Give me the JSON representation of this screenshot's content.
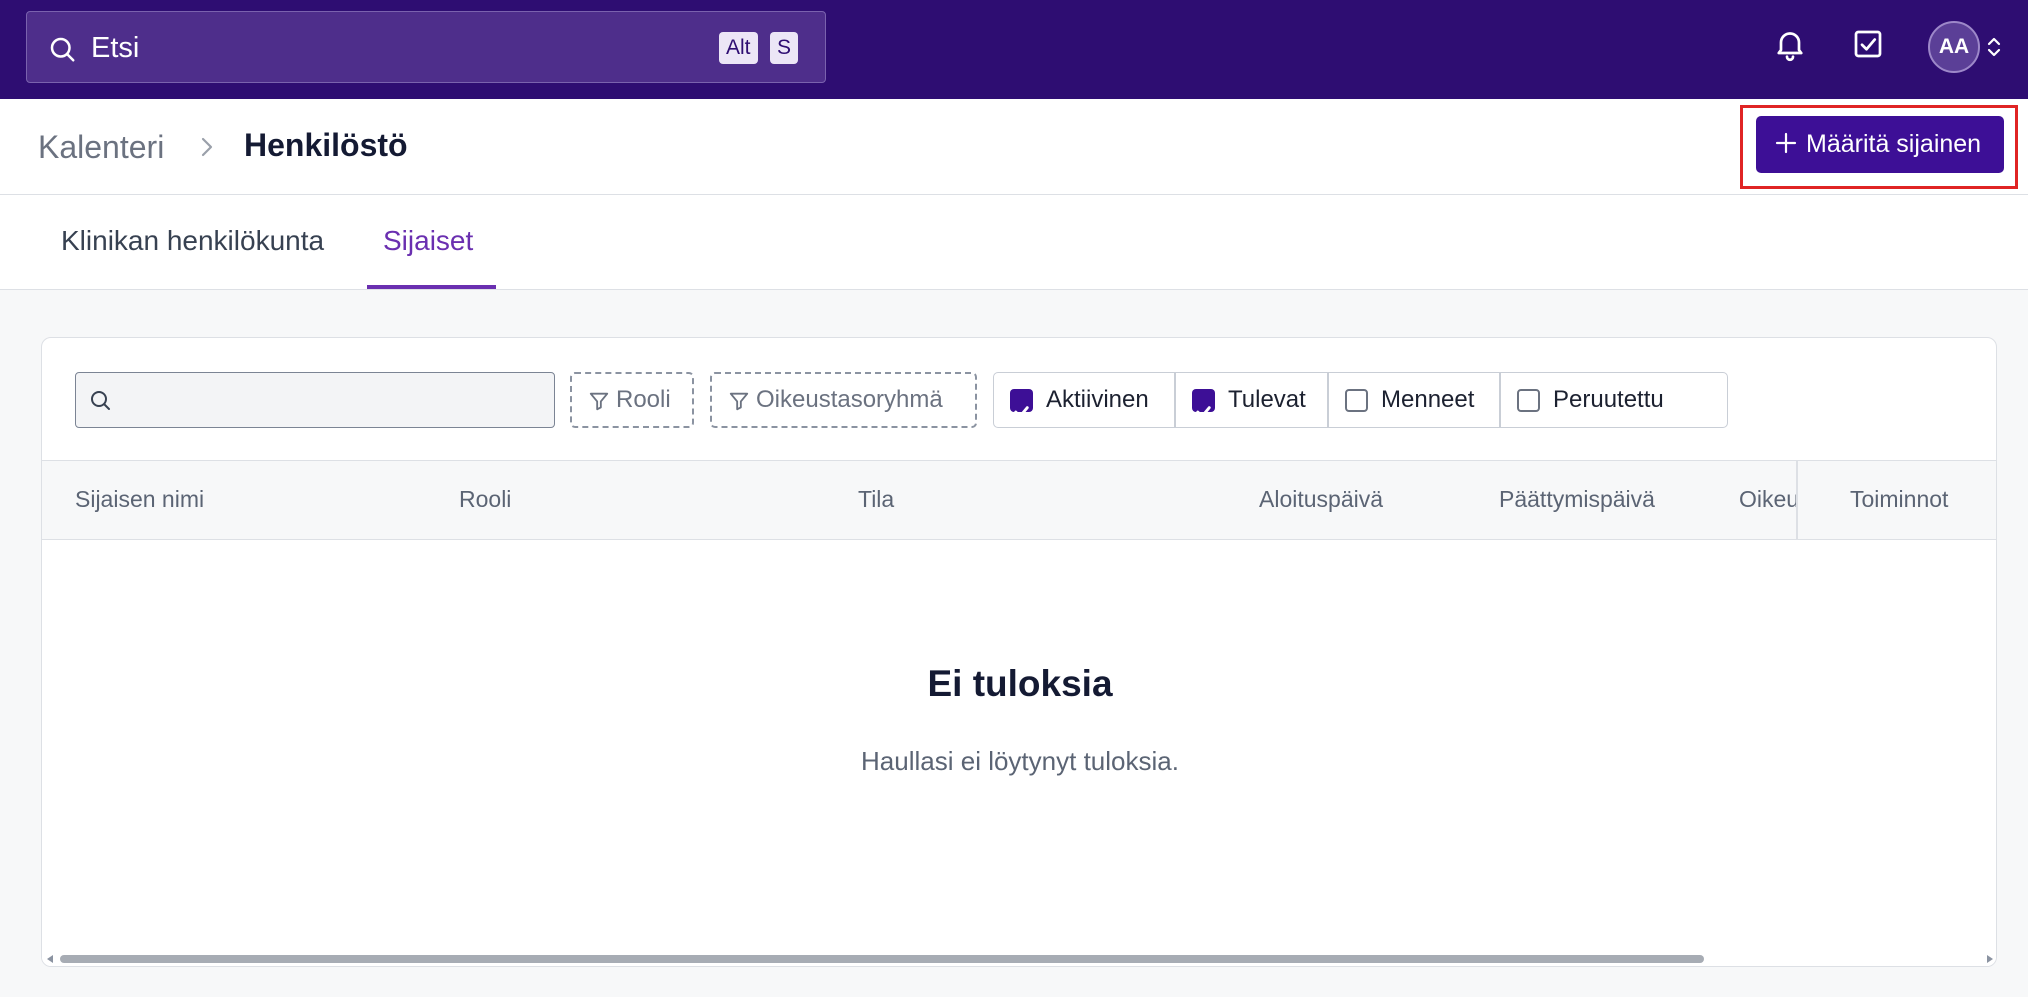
{
  "topbar": {
    "search_text": "Etsi",
    "shortcut_keys": [
      "Alt",
      "S"
    ],
    "avatar_initials": "AA",
    "icons": [
      "search-icon",
      "bell-icon",
      "task-check-icon",
      "chevron-updown-icon"
    ],
    "background_color": "#2e0d72"
  },
  "breadcrumb": {
    "parent": "Kalenteri",
    "current": "Henkilöstö"
  },
  "actions": {
    "assign_substitute_label": "Määritä sijainen",
    "primary_color": "#3d0f96"
  },
  "tabs": [
    {
      "label": "Klinikan henkilökunta",
      "active": false
    },
    {
      "label": "Sijaiset",
      "active": true
    }
  ],
  "filters": {
    "search_value": "",
    "role_label": "Rooli",
    "permission_group_label": "Oikeustasoryhmä",
    "status": [
      {
        "label": "Aktiivinen",
        "checked": true
      },
      {
        "label": "Tulevat",
        "checked": true
      },
      {
        "label": "Menneet",
        "checked": false
      },
      {
        "label": "Peruutettu",
        "checked": false
      }
    ]
  },
  "table": {
    "columns": [
      "Sijaisen nimi",
      "Rooli",
      "Tila",
      "Aloituspäivä",
      "Päättymispäivä",
      "Oikeu",
      "Toiminnot"
    ]
  },
  "empty_state": {
    "title": "Ei tuloksia",
    "subtitle": "Haullasi ei löytynyt tuloksia."
  }
}
